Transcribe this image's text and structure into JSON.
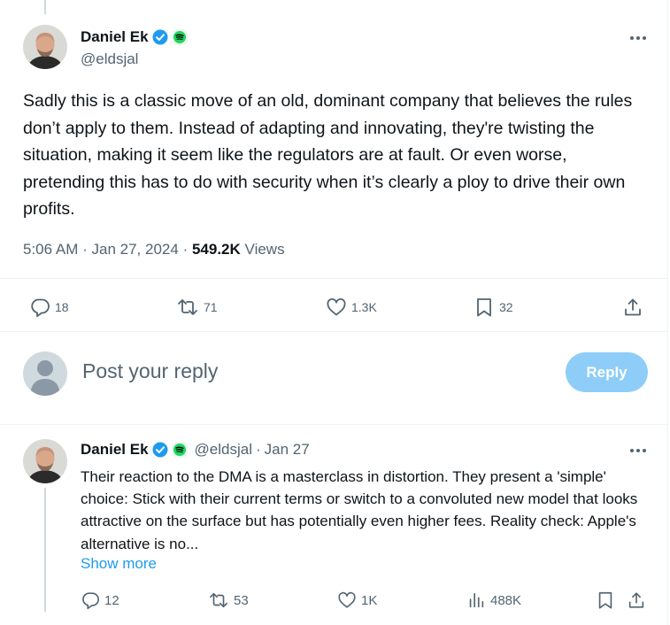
{
  "main_tweet": {
    "author_name": "Daniel Ek",
    "handle": "@eldsjal",
    "text": "Sadly this is a classic move of an old, dominant company that believes the rules don’t apply to them. Instead of adapting and innovating, they're twisting the situation, making it seem like the regulators are at fault. Or even worse, pretending this has to do with security when it’s clearly a ploy to drive their own profits.",
    "time": "5:06 AM",
    "date": "Jan 27, 2024",
    "views_count": "549.2K",
    "views_label": "Views",
    "replies": "18",
    "reposts": "71",
    "likes": "1.3K",
    "bookmarks": "32"
  },
  "compose": {
    "placeholder": "Post your reply",
    "button_label": "Reply"
  },
  "reply_tweet": {
    "author_name": "Daniel Ek",
    "handle": "@eldsjal",
    "date": "Jan 27",
    "text": "Their reaction to the DMA is a masterclass in distortion. They present a 'simple' choice: Stick with their current terms or switch to a convoluted new model that looks attractive on the surface but has potentially even higher fees. Reality check: Apple's alternative is no...",
    "show_more": "Show more",
    "replies": "12",
    "reposts": "53",
    "likes": "1K",
    "views": "488K"
  },
  "colors": {
    "text": "#0f1419",
    "secondary": "#536471",
    "accent": "#1d9bf0",
    "reply_button": "#8ecdf8",
    "verified": "#1d9bf0",
    "spotify": "#1ed760"
  }
}
